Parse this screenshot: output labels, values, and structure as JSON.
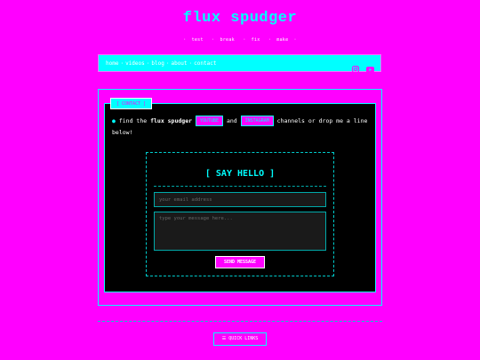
{
  "site": {
    "title": "flux spudger",
    "tagline": [
      "test",
      "break",
      "fix",
      "make"
    ]
  },
  "nav": {
    "links": [
      "home",
      "videos",
      "blog",
      "about",
      "contact"
    ],
    "icons": [
      "instagram-icon",
      "youtube-icon"
    ]
  },
  "contact": {
    "tab_label": "[ CONTACT ]",
    "intro_prefix": "find the",
    "intro_brand": "flux spudger",
    "youtube_label": "YOUTUBE",
    "and": "and",
    "instagram_label": "INSTAGRAM",
    "intro_suffix": "channels or drop me a line below!",
    "form_title": "[ SAY HELLO ]",
    "email_placeholder": "your email address",
    "message_placeholder": "type your message here...",
    "send_label": "SEND MESSAGE"
  },
  "footer": {
    "quick_links_label": "QUICK LINKS"
  },
  "colors": {
    "background": "#ff00ff",
    "accent": "#00ffff",
    "panel": "#000000"
  }
}
